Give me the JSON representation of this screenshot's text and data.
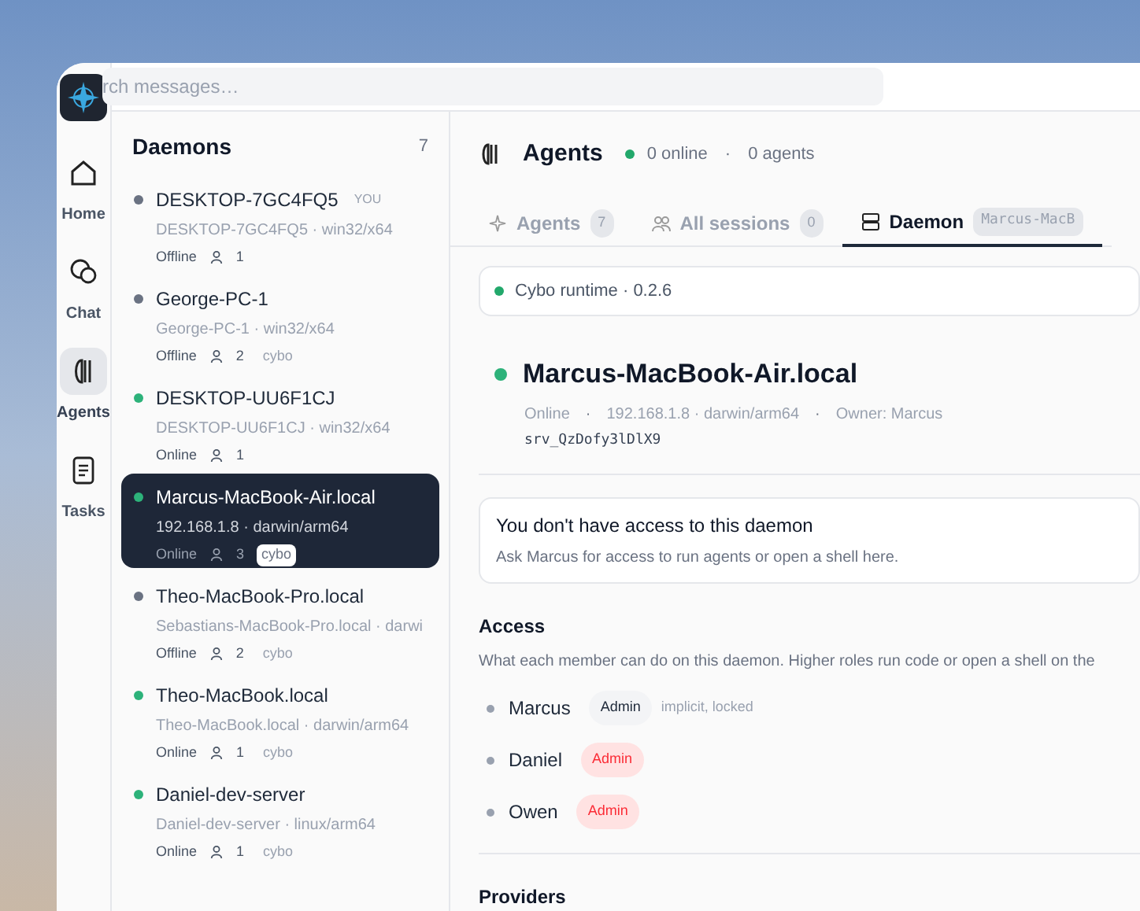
{
  "search": {
    "placeholder": "rch messages…"
  },
  "rail": [
    {
      "kind": "home",
      "label": "Home",
      "selected": false
    },
    {
      "kind": "chat",
      "label": "Chat",
      "selected": false
    },
    {
      "kind": "agents",
      "label": "Agents",
      "selected": true
    },
    {
      "kind": "tasks",
      "label": "Tasks",
      "selected": false
    }
  ],
  "sidebar": {
    "title": "Daemons",
    "count": "7",
    "items": [
      {
        "name": "DESKTOP-7GC4FQ5",
        "you": "YOU",
        "detail": "DESKTOP-7GC4FQ5 · win32/x64",
        "status": "Offline",
        "online": false,
        "members": "1",
        "selected": false
      },
      {
        "name": "George-PC-1",
        "detail": "George-PC-1 · win32/x64",
        "status": "Offline",
        "online": false,
        "members": "2",
        "tag": "cybo",
        "selected": false
      },
      {
        "name": "DESKTOP-UU6F1CJ",
        "detail": "DESKTOP-UU6F1CJ · win32/x64",
        "status": "Online",
        "online": true,
        "members": "1",
        "selected": false
      },
      {
        "name": "Marcus-MacBook-Air.local",
        "detail": "192.168.1.8 · darwin/arm64",
        "status": "Online",
        "online": true,
        "members": "3",
        "tag": "cybo",
        "selected": true
      },
      {
        "name": "Theo-MacBook-Pro.local",
        "detail": "Sebastians-MacBook-Pro.local · darwi",
        "status": "Offline",
        "online": false,
        "members": "2",
        "tag": "cybo",
        "selected": false
      },
      {
        "name": "Theo-MacBook.local",
        "detail": "Theo-MacBook.local · darwin/arm64",
        "status": "Online",
        "online": true,
        "members": "1",
        "tag": "cybo",
        "selected": false
      },
      {
        "name": "Daniel-dev-server",
        "detail": "Daniel-dev-server · linux/arm64",
        "status": "Online",
        "online": true,
        "members": "1",
        "tag": "cybo",
        "selected": false
      }
    ]
  },
  "header": {
    "title": "Agents",
    "online": "0 online",
    "separator": "·",
    "agents": "0 agents"
  },
  "tabs": [
    {
      "kind": "sparkle",
      "label": "Agents",
      "badge": "7",
      "selected": false
    },
    {
      "kind": "people",
      "label": "All sessions",
      "badge": "0",
      "selected": false
    },
    {
      "kind": "server",
      "label": "Daemon",
      "badge": "Marcus-MacB",
      "selected": true
    }
  ],
  "runtime": "Cybo runtime · 0.2.6",
  "daemon": {
    "name": "Marcus-MacBook-Air.local",
    "online": true,
    "status": "Online",
    "separator_1": "·",
    "address": "192.168.1.8 · darwin/arm64",
    "separator_2": "·",
    "owner": "Owner: Marcus",
    "id": "srv_QzDofy3lDlX9"
  },
  "notice": {
    "title": "You don't have access to this daemon",
    "text": "Ask Marcus for access to run agents or open a shell here."
  },
  "access": {
    "title": "Access",
    "text": "What each member can do on this daemon. Higher roles run code or open a shell on the",
    "members": [
      {
        "name": "Marcus",
        "role": "Admin",
        "locked": true,
        "note": "implicit, locked"
      },
      {
        "name": "Daniel",
        "role": "Admin",
        "locked": false
      },
      {
        "name": "Owen",
        "role": "Admin",
        "locked": false
      }
    ]
  },
  "providers": {
    "title": "Providers"
  }
}
